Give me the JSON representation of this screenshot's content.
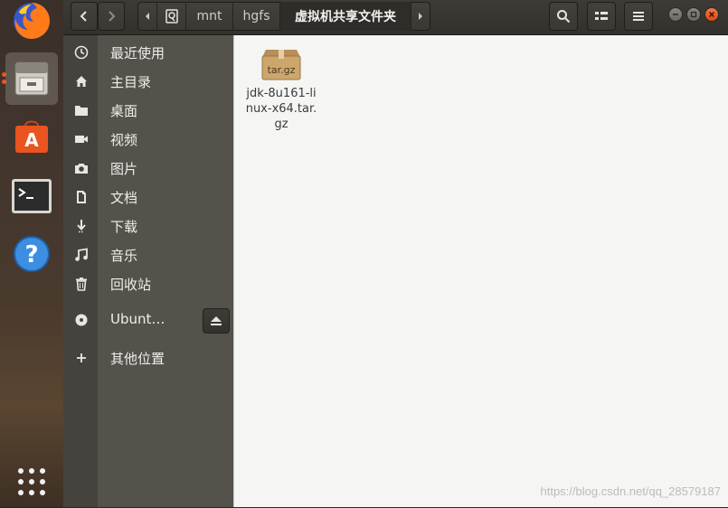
{
  "dock": {
    "items": [
      "firefox-icon",
      "files-icon",
      "software-icon",
      "terminal-icon",
      "help-icon",
      "apps-grid-icon"
    ]
  },
  "header": {
    "path": [
      "mnt",
      "hgfs",
      "虚拟机共享文件夹"
    ]
  },
  "sidebar": {
    "items": [
      {
        "label": "最近使用",
        "icon": "clock-icon"
      },
      {
        "label": "主目录",
        "icon": "home-icon"
      },
      {
        "label": "桌面",
        "icon": "folder-icon"
      },
      {
        "label": "视频",
        "icon": "video-icon"
      },
      {
        "label": "图片",
        "icon": "camera-icon"
      },
      {
        "label": "文档",
        "icon": "document-icon"
      },
      {
        "label": "下载",
        "icon": "download-icon"
      },
      {
        "label": "音乐",
        "icon": "music-icon"
      },
      {
        "label": "回收站",
        "icon": "trash-icon"
      },
      {
        "label": "Ubunt…",
        "icon": "disc-icon"
      },
      {
        "label": "其他位置",
        "icon": "plus-icon"
      }
    ]
  },
  "files": [
    {
      "icon_text": "tar.gz",
      "name": "jdk-8u161-linux-x64.tar.gz"
    }
  ],
  "watermark": "https://blog.csdn.net/qq_28579187",
  "colors": {
    "accent": "#e95420",
    "content_bg": "#f5f5f4",
    "sidebar_bg": "#55524c"
  }
}
